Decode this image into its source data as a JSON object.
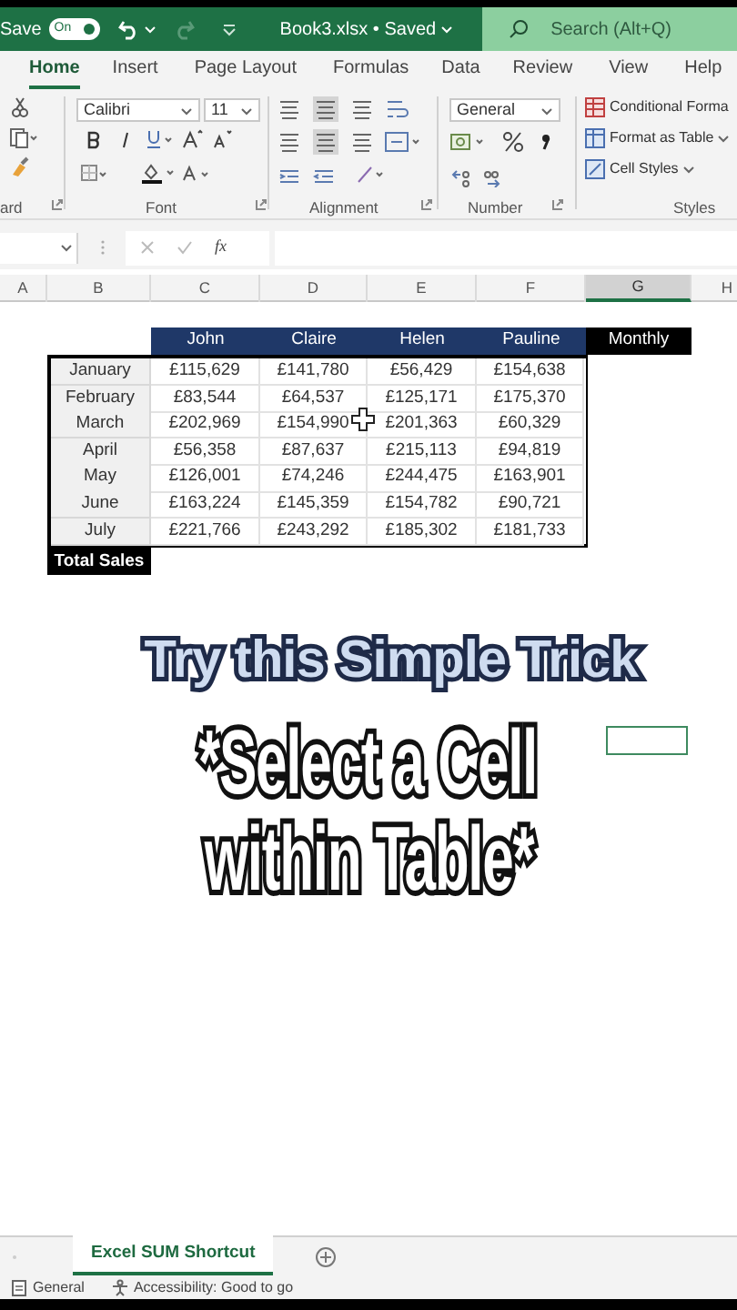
{
  "title_bar": {
    "autosave_label": "Save",
    "autosave_toggle": {
      "label": "On",
      "on": true
    },
    "file_name": "Book3.xlsx • Saved",
    "search": {
      "placeholder": "Search (Alt+Q)"
    }
  },
  "ribbon_tabs": [
    {
      "label": "Home",
      "selected": true
    },
    {
      "label": "Insert",
      "selected": false
    },
    {
      "label": "Page Layout",
      "selected": false
    },
    {
      "label": "Formulas",
      "selected": false
    },
    {
      "label": "Data",
      "selected": false
    },
    {
      "label": "Review",
      "selected": false
    },
    {
      "label": "View",
      "selected": false
    },
    {
      "label": "Help",
      "selected": false
    }
  ],
  "ribbon": {
    "font_name": "Calibri",
    "font_size": "11",
    "number_format": "General",
    "styles": [
      "Conditional Forma",
      "Format as Table",
      "Cell Styles"
    ],
    "group_labels": [
      "ard",
      "Font",
      "Alignment",
      "Number",
      "Styles"
    ]
  },
  "formula_bar": {
    "function_label": "fx"
  },
  "column_headers": [
    {
      "label": "A",
      "selected": false
    },
    {
      "label": "B",
      "selected": false
    },
    {
      "label": "C",
      "selected": false
    },
    {
      "label": "D",
      "selected": false
    },
    {
      "label": "E",
      "selected": false
    },
    {
      "label": "F",
      "selected": false
    },
    {
      "label": "G",
      "selected": true
    },
    {
      "label": "H",
      "selected": false
    }
  ],
  "table": {
    "columns": [
      "John",
      "Claire",
      "Helen",
      "Pauline"
    ],
    "extra_header": "Monthly",
    "rows": [
      {
        "label": "January",
        "values": [
          "£115,629",
          "£141,780",
          "£56,429",
          "£154,638"
        ]
      },
      {
        "label": "February",
        "values": [
          "£83,544",
          "£64,537",
          "£125,171",
          "£175,370"
        ]
      },
      {
        "label": "March",
        "values": [
          "£202,969",
          "£154,990",
          "£201,363",
          "£60,329"
        ]
      },
      {
        "label": "April",
        "values": [
          "£56,358",
          "£87,637",
          "£215,113",
          "£94,819"
        ]
      },
      {
        "label": "May",
        "values": [
          "£126,001",
          "£74,246",
          "£244,475",
          "£163,901"
        ]
      },
      {
        "label": "June",
        "values": [
          "£163,224",
          "£145,359",
          "£154,782",
          "£90,721"
        ]
      },
      {
        "label": "July",
        "values": [
          "£221,766",
          "£243,292",
          "£185,302",
          "£181,733"
        ]
      }
    ],
    "total_label": "Total Sales"
  },
  "overlay": {
    "headline": "Try this Simple Trick",
    "caption_lines": [
      "*Select a Cell",
      "within Table*"
    ]
  },
  "sheet_tabs": [
    {
      "label": "Excel SUM Shortcut",
      "selected": true
    }
  ],
  "status_bar": {
    "cell_mode": "General",
    "accessibility": "Accessibility: Good to go"
  }
}
